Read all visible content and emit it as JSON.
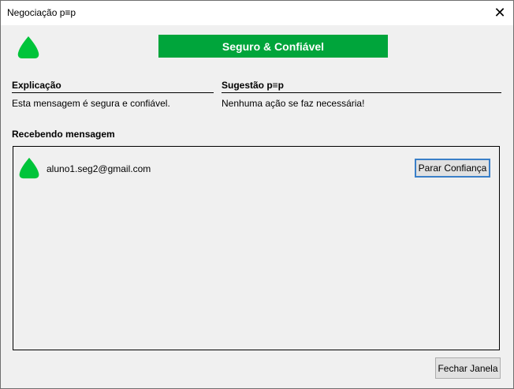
{
  "window": {
    "title": "Negociação p≡p",
    "close_glyph": "✕"
  },
  "header": {
    "status_icon": "shield-green-icon",
    "status_label": "Seguro & Confiável",
    "status_color": "#00a53b"
  },
  "explanation": {
    "heading": "Explicação",
    "text": "Esta mensagem é segura e confiável."
  },
  "suggestion": {
    "heading": "Sugestão p≡p",
    "text": "Nenhuma ação se faz necessária!"
  },
  "receiving": {
    "heading": "Recebendo mensagem",
    "contacts": [
      {
        "email": "aluno1.seg2@gmail.com",
        "icon": "shield-green-icon",
        "action_label": "Parar Confiança"
      }
    ]
  },
  "footer": {
    "close_label": "Fechar Janela"
  }
}
